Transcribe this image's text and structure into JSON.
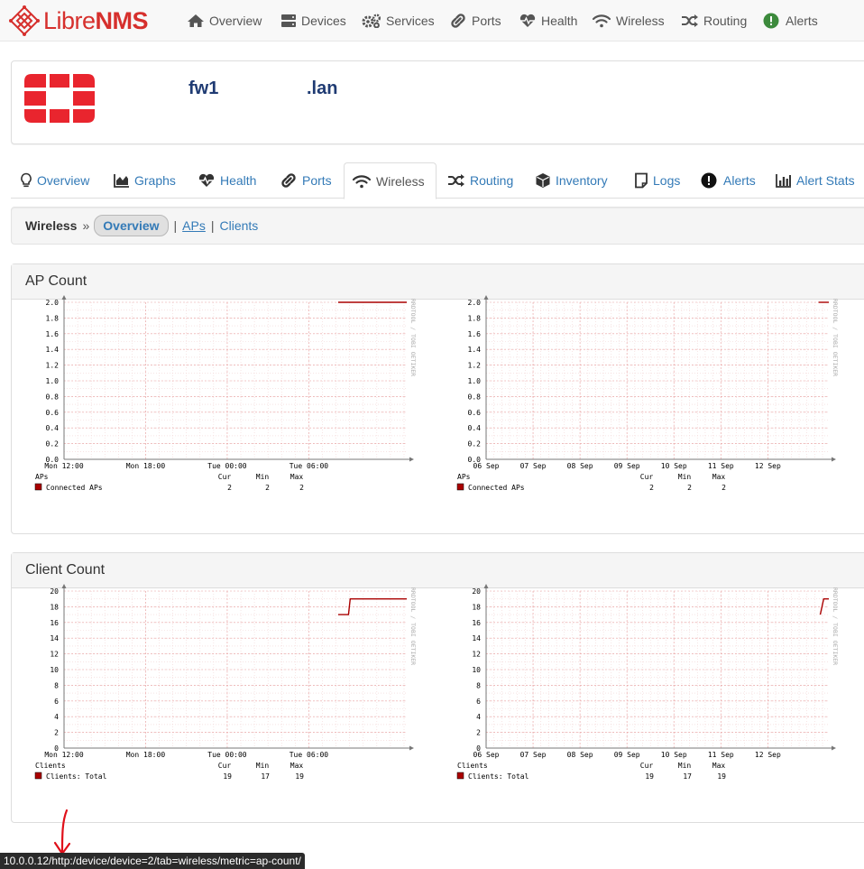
{
  "brand": {
    "prefix": "Libre",
    "suffix": "NMS"
  },
  "nav": [
    {
      "label": "Overview",
      "icon": "home-icon"
    },
    {
      "label": "Devices",
      "icon": "server-icon"
    },
    {
      "label": "Services",
      "icon": "cogs-icon"
    },
    {
      "label": "Ports",
      "icon": "link-icon"
    },
    {
      "label": "Health",
      "icon": "heartbeat-icon"
    },
    {
      "label": "Wireless",
      "icon": "wifi-icon"
    },
    {
      "label": "Routing",
      "icon": "random-icon"
    },
    {
      "label": "Alerts",
      "icon": "exclamation-circle-icon"
    }
  ],
  "device": {
    "host_part": "fw1",
    "domain_part": ".lan",
    "logo": "fortinet-logo"
  },
  "tabs": [
    {
      "label": "Overview",
      "icon": "lightbulb-icon"
    },
    {
      "label": "Graphs",
      "icon": "area-chart-icon"
    },
    {
      "label": "Health",
      "icon": "heartbeat-icon"
    },
    {
      "label": "Ports",
      "icon": "link-icon"
    },
    {
      "label": "Wireless",
      "icon": "wifi-icon",
      "active": true
    },
    {
      "label": "Routing",
      "icon": "random-icon"
    },
    {
      "label": "Inventory",
      "icon": "cube-icon"
    },
    {
      "label": "Logs",
      "icon": "file-icon"
    },
    {
      "label": "Alerts",
      "icon": "exclamation-circle-icon"
    },
    {
      "label": "Alert Stats",
      "icon": "bar-chart-icon"
    }
  ],
  "submenu": {
    "title": "Wireless",
    "arrow": "»",
    "active": "Overview",
    "sep": "|",
    "links": [
      "APs",
      "Clients"
    ]
  },
  "panels": [
    {
      "title": "AP Count"
    },
    {
      "title": "Client Count"
    }
  ],
  "watermark": "RRDTOOL / TOBI OETIKER",
  "chart_data": [
    {
      "type": "line",
      "panel": "AP Count",
      "range": "day",
      "x_ticks": [
        "Mon 12:00",
        "Mon 18:00",
        "Tue 00:00",
        "Tue 06:00"
      ],
      "y_ticks": [
        "0.0",
        "0.2",
        "0.4",
        "0.6",
        "0.8",
        "1.0",
        "1.2",
        "1.4",
        "1.6",
        "1.8",
        "2.0"
      ],
      "ylim": [
        0,
        2
      ],
      "legend_title": "APs",
      "columns": [
        "Cur",
        "Min",
        "Max"
      ],
      "series": [
        {
          "name": "Connected APs",
          "color": "#aa0000",
          "cur": "2",
          "min": "2",
          "max": "2",
          "points": [
            [
              0.8,
              2
            ],
            [
              1.0,
              2
            ]
          ]
        }
      ]
    },
    {
      "type": "line",
      "panel": "AP Count",
      "range": "week",
      "x_ticks": [
        "06 Sep",
        "07 Sep",
        "08 Sep",
        "09 Sep",
        "10 Sep",
        "11 Sep",
        "12 Sep"
      ],
      "y_ticks": [
        "0.0",
        "0.2",
        "0.4",
        "0.6",
        "0.8",
        "1.0",
        "1.2",
        "1.4",
        "1.6",
        "1.8",
        "2.0"
      ],
      "ylim": [
        0,
        2
      ],
      "legend_title": "APs",
      "columns": [
        "Cur",
        "Min",
        "Max"
      ],
      "series": [
        {
          "name": "Connected APs",
          "color": "#aa0000",
          "cur": "2",
          "min": "2",
          "max": "2",
          "points": [
            [
              0.97,
              2
            ],
            [
              1.0,
              2
            ]
          ]
        }
      ]
    },
    {
      "type": "line",
      "panel": "Client Count",
      "range": "day",
      "x_ticks": [
        "Mon 12:00",
        "Mon 18:00",
        "Tue 00:00",
        "Tue 06:00"
      ],
      "y_ticks": [
        "0",
        "2",
        "4",
        "6",
        "8",
        "10",
        "12",
        "14",
        "16",
        "18",
        "20"
      ],
      "ylim": [
        0,
        20
      ],
      "legend_title": "Clients",
      "columns": [
        "Cur",
        "Min",
        "Max"
      ],
      "series": [
        {
          "name": "Clients: Total",
          "color": "#aa0000",
          "cur": "19",
          "min": "17",
          "max": "19",
          "points": [
            [
              0.8,
              17
            ],
            [
              0.83,
              17
            ],
            [
              0.835,
              19
            ],
            [
              1.0,
              19
            ]
          ]
        }
      ]
    },
    {
      "type": "line",
      "panel": "Client Count",
      "range": "week",
      "x_ticks": [
        "06 Sep",
        "07 Sep",
        "08 Sep",
        "09 Sep",
        "10 Sep",
        "11 Sep",
        "12 Sep"
      ],
      "y_ticks": [
        "0",
        "2",
        "4",
        "6",
        "8",
        "10",
        "12",
        "14",
        "16",
        "18",
        "20"
      ],
      "ylim": [
        0,
        20
      ],
      "legend_title": "Clients",
      "columns": [
        "Cur",
        "Min",
        "Max"
      ],
      "series": [
        {
          "name": "Clients: Total",
          "color": "#aa0000",
          "cur": "19",
          "min": "17",
          "max": "19",
          "points": [
            [
              0.975,
              17
            ],
            [
              0.985,
              19
            ],
            [
              1.0,
              19
            ]
          ]
        }
      ]
    }
  ],
  "statusbar": {
    "url": "10.0.0.12/http:/device/device=2/tab=wireless/metric=ap-count/"
  }
}
